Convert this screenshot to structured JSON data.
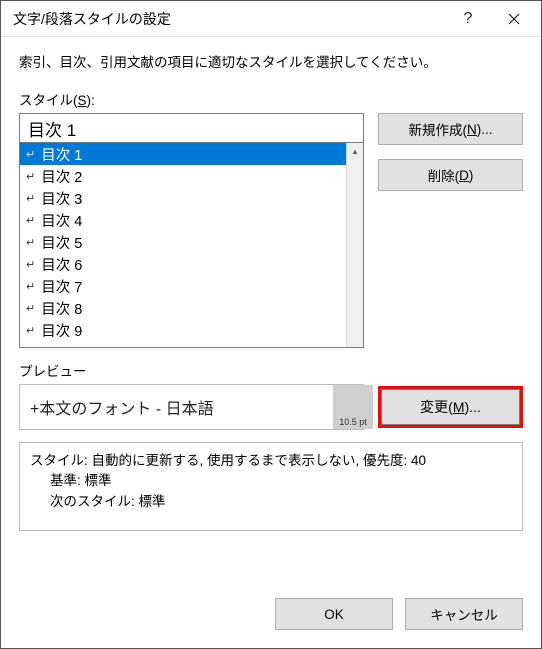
{
  "titlebar": {
    "title": "文字/段落スタイルの設定"
  },
  "description": "索引、目次、引用文献の項目に適切なスタイルを選択してください。",
  "style_label_prefix": "スタイル(",
  "style_label_accel": "S",
  "style_label_suffix": "):",
  "style_input_value": "目次 1",
  "list_items": [
    {
      "label": "目次 1",
      "selected": true
    },
    {
      "label": "目次 2",
      "selected": false
    },
    {
      "label": "目次 3",
      "selected": false
    },
    {
      "label": "目次 4",
      "selected": false
    },
    {
      "label": "目次 5",
      "selected": false
    },
    {
      "label": "目次 6",
      "selected": false
    },
    {
      "label": "目次 7",
      "selected": false
    },
    {
      "label": "目次 8",
      "selected": false
    },
    {
      "label": "目次 9",
      "selected": false
    }
  ],
  "buttons": {
    "new_prefix": "新規作成(",
    "new_accel": "N",
    "new_suffix": ")...",
    "delete_prefix": "削除(",
    "delete_accel": "D",
    "delete_suffix": ")",
    "modify_prefix": "変更(",
    "modify_accel": "M",
    "modify_suffix": ")...",
    "ok": "OK",
    "cancel": "キャンセル"
  },
  "preview": {
    "label": "プレビュー",
    "text": "+本文のフォント - 日本語",
    "pt": "10.5 pt"
  },
  "info": {
    "line1": "スタイル: 自動的に更新する, 使用するまで表示しない, 優先度: 40",
    "line2": "基準: 標準",
    "line3": "次のスタイル: 標準"
  }
}
